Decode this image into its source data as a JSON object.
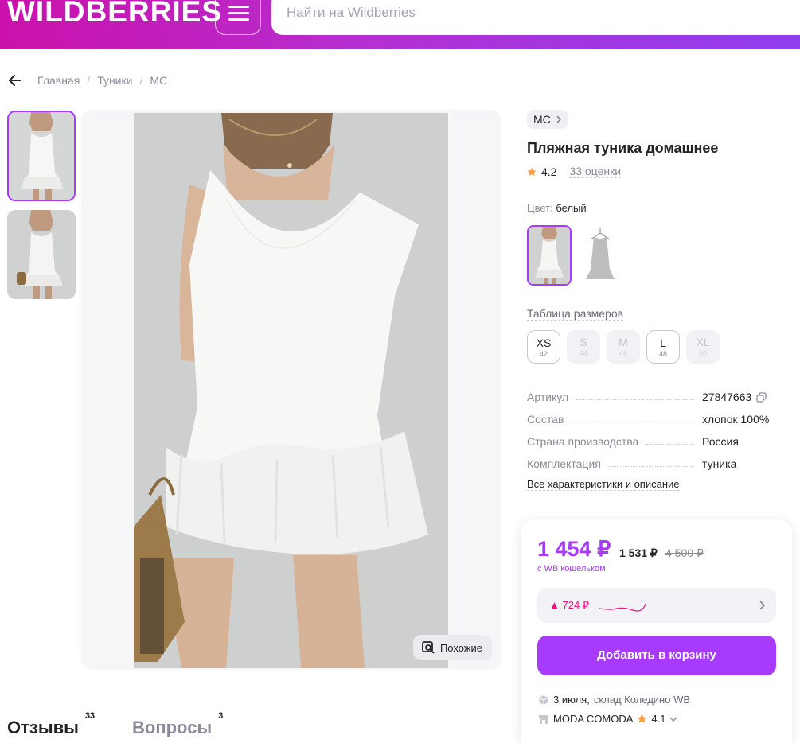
{
  "header": {
    "logo": "WILDBERRIES",
    "search_placeholder": "Найти на Wildberries"
  },
  "breadcrumb": {
    "items": [
      "Главная",
      "Туники",
      "MC"
    ],
    "separator": "/"
  },
  "gallery": {
    "similar_label": "Похожие"
  },
  "product": {
    "brand": "MC",
    "title": "Пляжная туника домашнее",
    "rating": "4.2",
    "reviews_count": "33 оценки",
    "color_label": "Цвет:",
    "color_value": "белый",
    "size_table_label": "Таблица размеров",
    "sizes": [
      {
        "label": "XS",
        "ru": "42",
        "available": true
      },
      {
        "label": "S",
        "ru": "44",
        "available": false
      },
      {
        "label": "M",
        "ru": "46",
        "available": false
      },
      {
        "label": "L",
        "ru": "48",
        "available": true
      },
      {
        "label": "XL",
        "ru": "50",
        "available": false
      }
    ],
    "specs": [
      {
        "key": "Артикул",
        "value": "27847663"
      },
      {
        "key": "Состав",
        "value": "хлопок 100%"
      },
      {
        "key": "Страна производства",
        "value": "Россия"
      },
      {
        "key": "Комплектация",
        "value": "туника"
      }
    ],
    "all_chars_link": "Все характеристики и описание"
  },
  "price_card": {
    "wallet_price": "1 454 ₽",
    "price": "1 531 ₽",
    "old_price": "4 500 ₽",
    "wallet_note": "с WB кошельком",
    "price_change": "▲ 724 ₽",
    "add_to_cart": "Добавить в корзину",
    "delivery_date": "3 июля,",
    "warehouse": "склад Коледино WB",
    "seller": "MODA COMODA",
    "seller_rating": "4.1"
  },
  "tabs": [
    {
      "label": "Отзывы",
      "count": "33"
    },
    {
      "label": "Вопросы",
      "count": "3"
    }
  ],
  "colors": {
    "accent": "#a73afd",
    "brand_gradient_start": "#cb11ab",
    "brand_gradient_end": "#8f3df0",
    "star": "#ff9d42",
    "price_up": "#f1117e"
  }
}
